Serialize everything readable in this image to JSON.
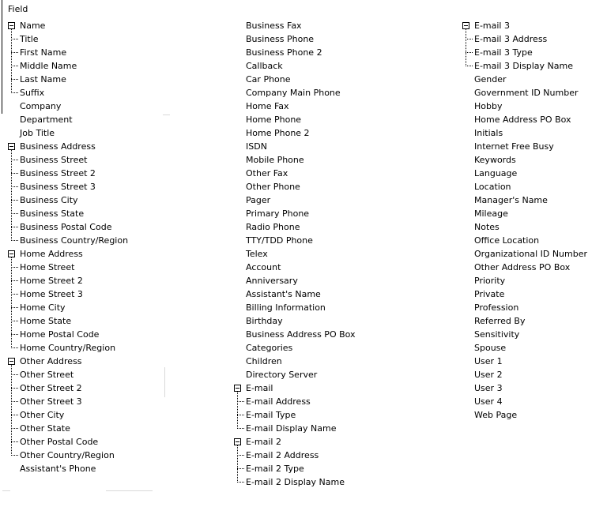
{
  "header": {
    "title": "Field"
  },
  "columns": [
    {
      "items": [
        {
          "label": "Name",
          "expanded": true,
          "children": [
            "Title",
            "First Name",
            "Middle Name",
            "Last Name",
            "Suffix"
          ]
        },
        {
          "label": "Company"
        },
        {
          "label": "Department"
        },
        {
          "label": "Job Title"
        },
        {
          "label": "Business Address",
          "expanded": true,
          "children": [
            "Business Street",
            "Business Street 2",
            "Business Street 3",
            "Business City",
            "Business State",
            "Business Postal Code",
            "Business Country/Region"
          ]
        },
        {
          "label": "Home Address",
          "expanded": true,
          "children": [
            "Home Street",
            "Home Street 2",
            "Home Street 3",
            "Home City",
            "Home State",
            "Home Postal Code",
            "Home Country/Region"
          ]
        },
        {
          "label": "Other Address",
          "expanded": true,
          "children": [
            "Other Street",
            "Other Street 2",
            "Other Street 3",
            "Other City",
            "Other State",
            "Other Postal Code",
            "Other Country/Region"
          ]
        },
        {
          "label": "Assistant's Phone"
        }
      ]
    },
    {
      "items": [
        {
          "label": "Business Fax"
        },
        {
          "label": "Business Phone"
        },
        {
          "label": "Business Phone 2"
        },
        {
          "label": "Callback"
        },
        {
          "label": "Car Phone"
        },
        {
          "label": "Company Main Phone"
        },
        {
          "label": "Home Fax"
        },
        {
          "label": "Home Phone"
        },
        {
          "label": "Home Phone 2"
        },
        {
          "label": "ISDN"
        },
        {
          "label": "Mobile Phone"
        },
        {
          "label": "Other Fax"
        },
        {
          "label": "Other Phone"
        },
        {
          "label": "Pager"
        },
        {
          "label": "Primary Phone"
        },
        {
          "label": "Radio Phone"
        },
        {
          "label": "TTY/TDD Phone"
        },
        {
          "label": "Telex"
        },
        {
          "label": "Account"
        },
        {
          "label": "Anniversary"
        },
        {
          "label": "Assistant's Name"
        },
        {
          "label": "Billing Information"
        },
        {
          "label": "Birthday"
        },
        {
          "label": "Business Address PO Box"
        },
        {
          "label": "Categories"
        },
        {
          "label": "Children"
        },
        {
          "label": "Directory Server"
        },
        {
          "label": "E-mail",
          "expanded": true,
          "children": [
            "E-mail Address",
            "E-mail Type",
            "E-mail Display Name"
          ]
        },
        {
          "label": "E-mail 2",
          "expanded": true,
          "children": [
            "E-mail 2 Address",
            "E-mail 2 Type",
            "E-mail 2 Display Name"
          ]
        }
      ]
    },
    {
      "items": [
        {
          "label": "E-mail 3",
          "expanded": true,
          "children": [
            "E-mail 3 Address",
            "E-mail 3 Type",
            "E-mail 3 Display Name"
          ]
        },
        {
          "label": "Gender"
        },
        {
          "label": "Government ID Number"
        },
        {
          "label": "Hobby"
        },
        {
          "label": "Home Address PO Box"
        },
        {
          "label": "Initials"
        },
        {
          "label": "Internet Free Busy"
        },
        {
          "label": "Keywords"
        },
        {
          "label": "Language"
        },
        {
          "label": "Location"
        },
        {
          "label": "Manager's Name"
        },
        {
          "label": "Mileage"
        },
        {
          "label": "Notes"
        },
        {
          "label": "Office Location"
        },
        {
          "label": "Organizational ID Number"
        },
        {
          "label": "Other Address PO Box"
        },
        {
          "label": "Priority"
        },
        {
          "label": "Private"
        },
        {
          "label": "Profession"
        },
        {
          "label": "Referred By"
        },
        {
          "label": "Sensitivity"
        },
        {
          "label": "Spouse"
        },
        {
          "label": "User 1"
        },
        {
          "label": "User 2"
        },
        {
          "label": "User 3"
        },
        {
          "label": "User 4"
        },
        {
          "label": "Web Page"
        }
      ]
    }
  ]
}
